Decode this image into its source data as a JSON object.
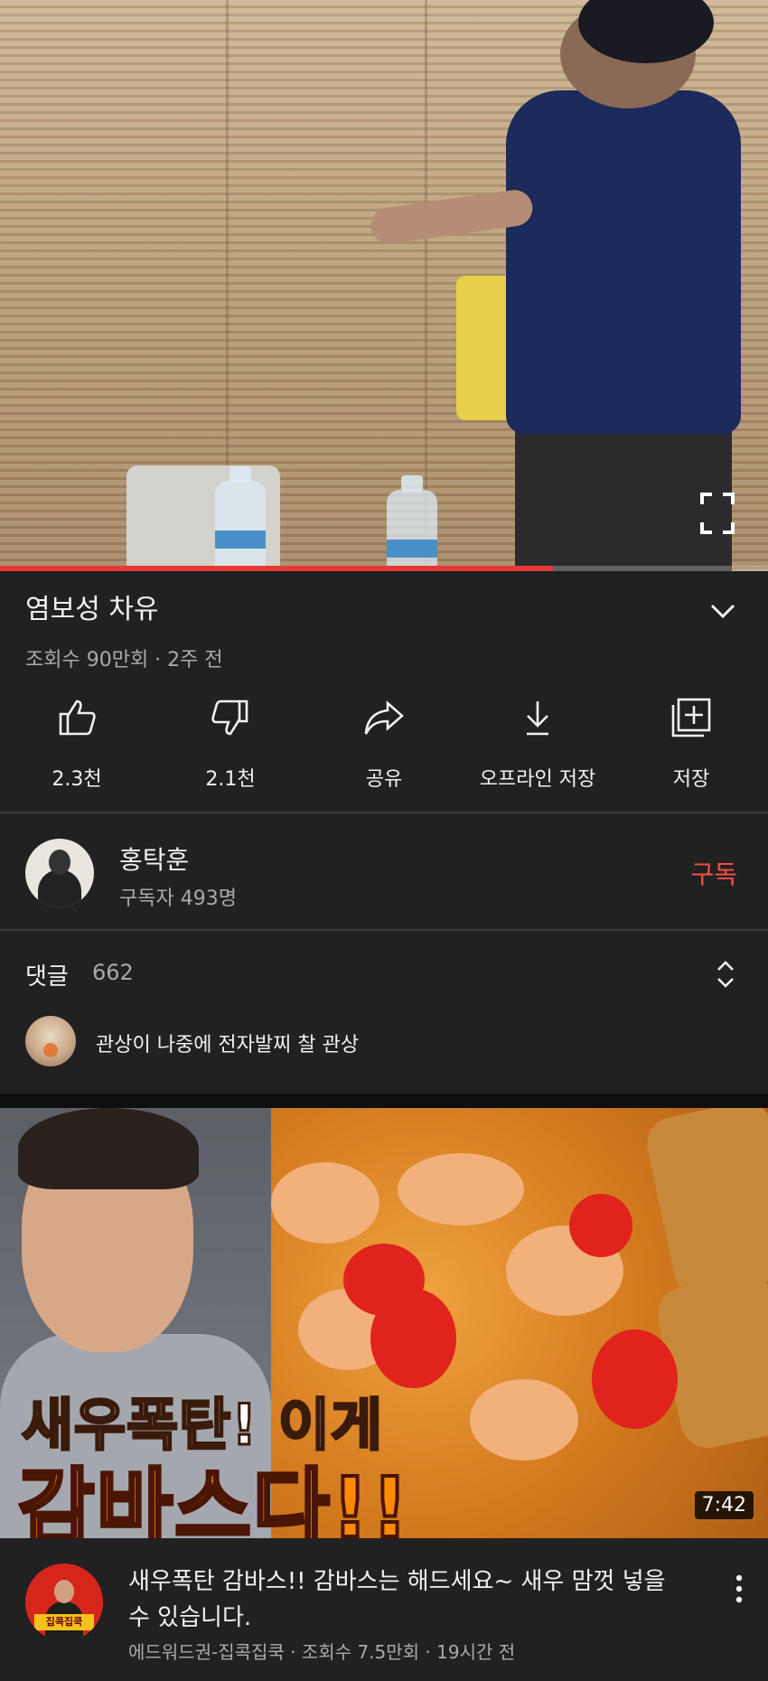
{
  "video": {
    "title": "염보성 차유",
    "meta": "조회수 90만회 · 2주 전",
    "progress": 0.72
  },
  "actions": [
    {
      "label": "2.3천",
      "icon": "thumbs-up-icon"
    },
    {
      "label": "2.1천",
      "icon": "thumbs-down-icon"
    },
    {
      "label": "공유",
      "icon": "share-icon"
    },
    {
      "label": "오프라인 저장",
      "icon": "download-icon"
    },
    {
      "label": "저장",
      "icon": "add-to-playlist-icon"
    }
  ],
  "channel": {
    "name": "홍탁훈",
    "subscribers": "구독자 493명",
    "subscribe_label": "구독"
  },
  "comments": {
    "header": "댓글",
    "count": "662",
    "top_comment": "관상이  나중에 전자발찌 찰 관상"
  },
  "recommended": {
    "thumb_line1": "새우폭탄! 이게",
    "thumb_line2": "감바스다!!",
    "duration": "7:42",
    "channel_badge": "집콕집쿡",
    "title": "새우폭탄 감바스!! 감바스는 해드세요~ 새우 맘껏 넣을 수 있습니다.",
    "meta": "에드워드권-집콕집쿡 · 조회수 7.5만회 · 19시간 전"
  },
  "colors": {
    "background": "#212121",
    "accent_red": "#ff4e45",
    "progress_red": "#e53935",
    "secondary_text": "#aaaaaa"
  }
}
